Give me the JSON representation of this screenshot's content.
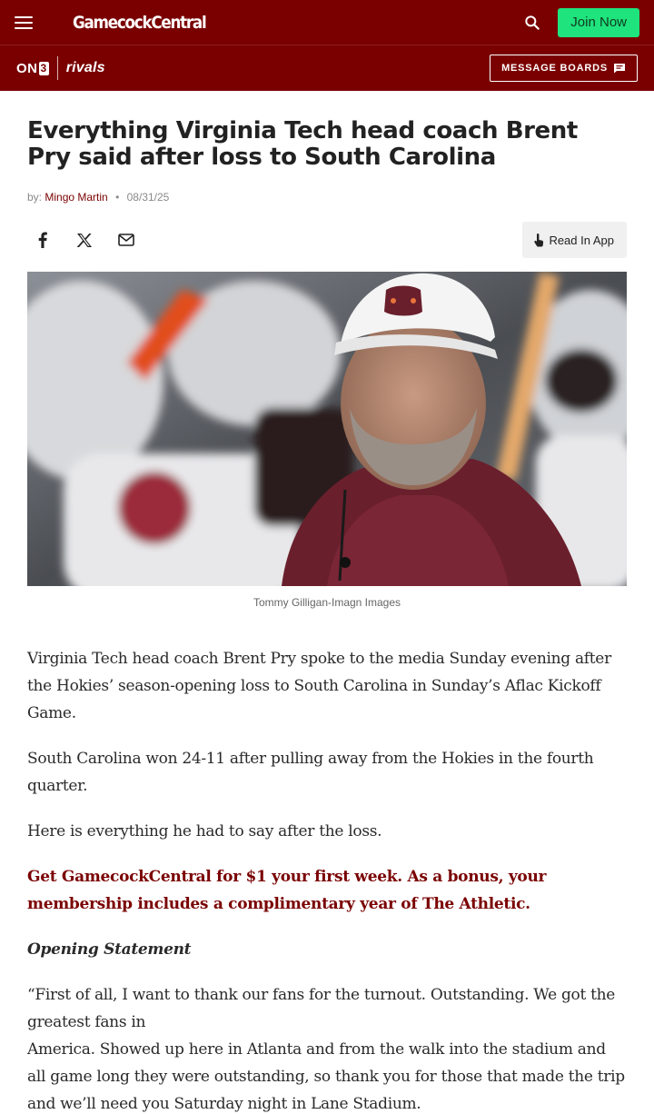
{
  "header": {
    "brand": "GamecockCentral",
    "join_label": "Join Now",
    "icons": [
      "menu-icon",
      "search-icon"
    ]
  },
  "subheader": {
    "on3_prefix": "ON",
    "on3_suffix": "3",
    "rivals": "rivals",
    "message_boards": "MESSAGE BOARDS"
  },
  "article": {
    "title": "Everything Virginia Tech head coach Brent Pry said after loss to South Carolina",
    "by_label": "by:",
    "author": "Mingo Martin",
    "date": "08/31/25",
    "share_icons": [
      "facebook-icon",
      "x-icon",
      "email-icon"
    ],
    "read_in_app": "Read In App",
    "image_caption": "Tommy Gilligan-Imagn Images",
    "paragraphs": [
      "Virginia Tech head coach Brent Pry spoke to the media Sunday evening after the Hokies’ season-opening loss to South Carolina in Sunday’s Aflac Kickoff Game.",
      "South Carolina won 24-11 after pulling away from the Hokies in the fourth quarter.",
      "Here is everything he had to say after the loss."
    ],
    "promo": "Get GamecockCentral for $1 your first week. As a bonus, your membership includes a complimentary year of The Athletic.",
    "subheading": "Opening Statement",
    "quote_line1": "“First of all, I want to thank our fans for the turnout. Outstanding. We got the greatest fans in",
    "quote_line2": "America. Showed up here in Atlanta and from the walk into the stadium and all game long they were outstanding, so thank you for those that made the trip and we’ll need you Saturday night in Lane Stadium."
  },
  "colors": {
    "brand_red": "#7a0000",
    "join_green": "#1fe37d",
    "text": "#2a2a2a"
  }
}
